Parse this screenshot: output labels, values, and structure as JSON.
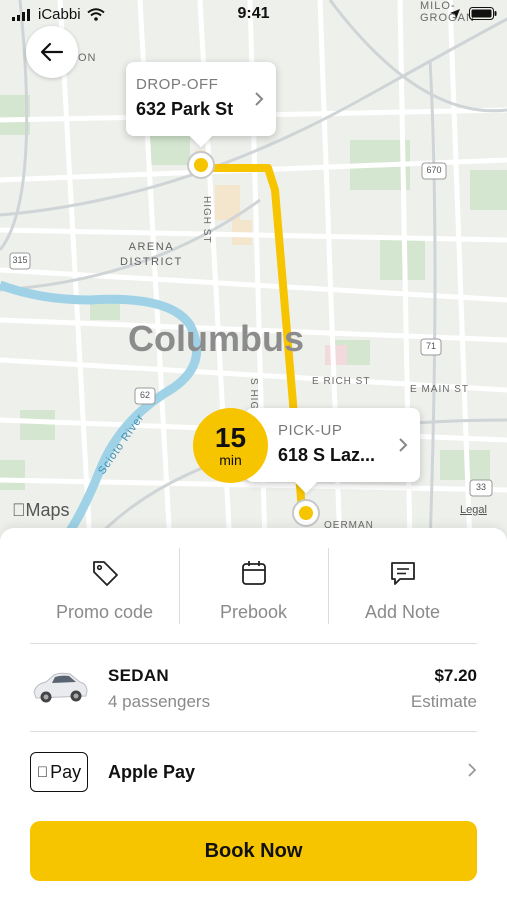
{
  "status_bar": {
    "carrier": "iCabbi",
    "time": "9:41"
  },
  "map": {
    "city_label": "Columbus",
    "district_label_1": "ARENA",
    "district_label_2": "DISTRICT",
    "street_high": "HIGH ST",
    "street_s_high": "S HIGH",
    "street_e_rich": "E RICH ST",
    "street_e_main": "E MAIN ST",
    "river_label": "Scioto River",
    "corner_label": "MILO-GROGAN",
    "road_fragment": "ON",
    "road_bottom": "OERMAN",
    "shields": [
      "315",
      "670",
      "71",
      "62",
      "33"
    ],
    "maps_attribution": "Maps",
    "legal": "Legal",
    "route_color": "#f7c400"
  },
  "dropoff": {
    "label": "DROP-OFF",
    "address": "632 Park St"
  },
  "pickup": {
    "label": "PICK-UP",
    "address": "618 S Laz..."
  },
  "eta": {
    "value": "15",
    "unit": "min"
  },
  "actions": [
    {
      "label": "Promo code",
      "icon": "tag-icon"
    },
    {
      "label": "Prebook",
      "icon": "calendar-icon"
    },
    {
      "label": "Add Note",
      "icon": "note-icon"
    }
  ],
  "vehicle": {
    "type": "SEDAN",
    "passengers": "4 passengers",
    "price": "$7.20",
    "price_note": "Estimate"
  },
  "payment": {
    "badge": "Pay",
    "method": "Apple Pay"
  },
  "book_button": {
    "label": "Book Now"
  },
  "colors": {
    "accent": "#f7c400"
  }
}
